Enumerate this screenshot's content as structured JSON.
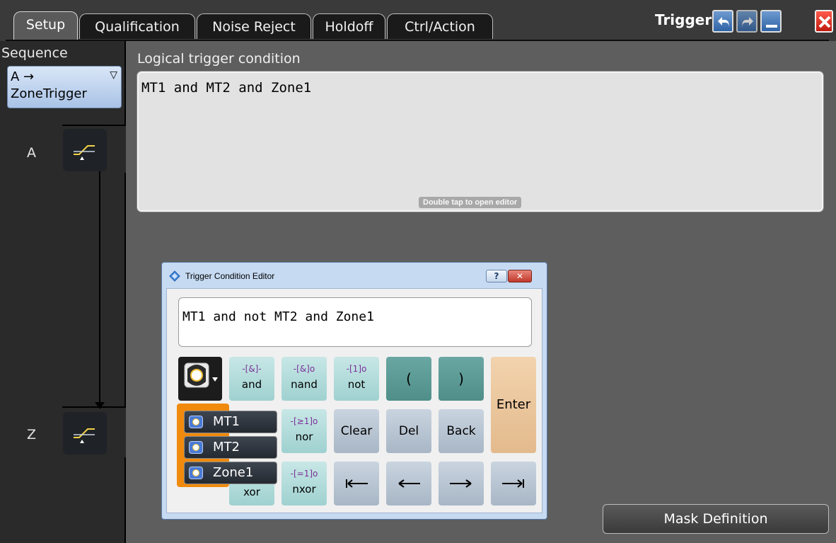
{
  "tabs": [
    {
      "label": "Setup",
      "active": true
    },
    {
      "label": "Qualification",
      "active": false
    },
    {
      "label": "Noise Reject",
      "active": false
    },
    {
      "label": "Holdoff",
      "active": false
    },
    {
      "label": "Ctrl/Action",
      "active": false
    }
  ],
  "window": {
    "title": "Trigger",
    "buttons": [
      "undo-icon",
      "redo-icon",
      "minimize-icon",
      "close-icon"
    ]
  },
  "sequence": {
    "label": "Sequence",
    "value_line1": "A →",
    "value_line2": "ZoneTrigger",
    "stages": [
      {
        "letter": "A",
        "icon": "edge-trigger-icon"
      },
      {
        "letter": "Z",
        "icon": "edge-trigger-icon"
      }
    ]
  },
  "condition": {
    "label": "Logical trigger condition",
    "value": "MT1 and MT2 and Zone1",
    "hint": "Double tap to open editor"
  },
  "mask_button": "Mask Definition",
  "editor": {
    "title": "Trigger Condition Editor",
    "help": "?",
    "input_value": "MT1 and not MT2 and Zone1",
    "keys": {
      "and": {
        "glyph": "&",
        "label": "and"
      },
      "nand": {
        "glyph": "&",
        "label": "nand"
      },
      "not": {
        "glyph": "1",
        "label": "not"
      },
      "nor": {
        "glyph": "≥1",
        "label": "nor"
      },
      "xor": {
        "label": "xor"
      },
      "nxor": {
        "glyph": "=1",
        "label": "nxor"
      },
      "open_paren": "(",
      "close_paren": ")",
      "enter": "Enter",
      "clear": "Clear",
      "del": "Del",
      "back": "Back"
    },
    "sources": [
      "MT1",
      "MT2",
      "Zone1"
    ]
  },
  "colors": {
    "panel": "#5e5e5e",
    "dialog": "#c6daf2",
    "accent_orange": "#f08a0c",
    "teal_key": "#9fd1d0",
    "dark_teal_key": "#4f8e89",
    "close_red": "#e0281c"
  }
}
